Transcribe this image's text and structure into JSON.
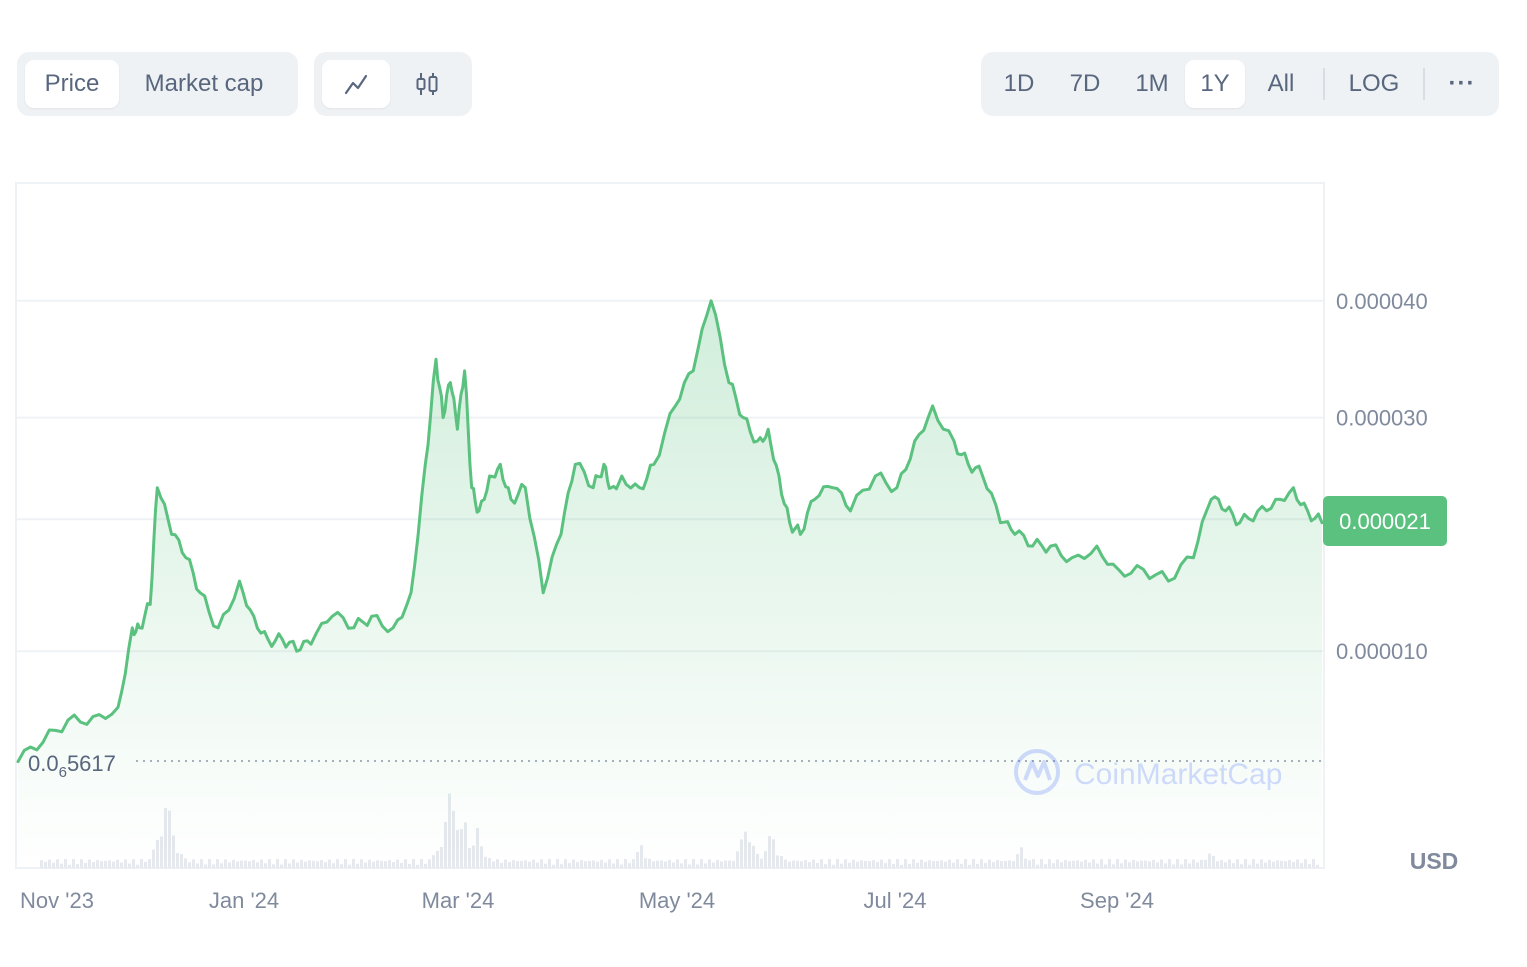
{
  "toggles": {
    "price_label": "Price",
    "market_cap_label": "Market cap",
    "line_icon": "line-chart-icon",
    "candle_icon": "candlestick-icon"
  },
  "ranges": {
    "items": [
      "1D",
      "7D",
      "1M",
      "1Y",
      "All"
    ],
    "active": "1Y",
    "log_label": "LOG",
    "more_label": "···"
  },
  "colors": {
    "line": "#5bc17f",
    "badge_bg": "#5bc17f",
    "badge_text": "#ffffff",
    "grid": "#eff2f5",
    "axis_text": "#808a9d"
  },
  "watermark": "CoinMarketCap",
  "currency_label": "USD",
  "chart_data": {
    "type": "line",
    "title": "",
    "xlabel": "",
    "ylabel": "",
    "x_ticks": [
      "Nov '23",
      "Jan '24",
      "Mar '24",
      "May '24",
      "Jul '24",
      "Sep '24"
    ],
    "y_ticks": [
      "0.000040",
      "0.000030",
      "0.000010"
    ],
    "y_tick_values": [
      4e-05,
      3e-05,
      1e-05
    ],
    "ylim": [
      0.0,
      5e-05
    ],
    "current_price_label": "0.000021",
    "current_price": 2.1e-05,
    "baseline_label_prefix": "0.0",
    "baseline_label_sub": "6",
    "baseline_label_suffix": "5617",
    "baseline_value": 5.617e-07,
    "grid": true,
    "volume_shown": true,
    "series": [
      {
        "x": [
          "2023-11-01",
          "2023-11-08",
          "2023-11-15",
          "2023-11-22",
          "2023-11-29",
          "2023-12-03",
          "2023-12-05",
          "2023-12-08",
          "2023-12-10",
          "2023-12-14",
          "2023-12-18",
          "2023-12-22",
          "2023-12-27",
          "2024-01-02",
          "2024-01-06",
          "2024-01-10",
          "2024-01-14",
          "2024-01-18",
          "2024-01-22",
          "2024-01-28",
          "2024-02-03",
          "2024-02-08",
          "2024-02-14",
          "2024-02-19",
          "2024-02-23",
          "2024-02-26",
          "2024-02-28",
          "2024-03-01",
          "2024-03-03",
          "2024-03-05",
          "2024-03-07",
          "2024-03-09",
          "2024-03-12",
          "2024-03-15",
          "2024-03-18",
          "2024-03-22",
          "2024-03-27",
          "2024-04-01",
          "2024-04-05",
          "2024-04-10",
          "2024-04-13",
          "2024-04-15",
          "2024-04-18",
          "2024-04-23",
          "2024-04-27",
          "2024-05-03",
          "2024-05-08",
          "2024-05-13",
          "2024-05-18",
          "2024-05-22",
          "2024-05-26",
          "2024-05-29",
          "2024-06-01",
          "2024-06-04",
          "2024-06-07",
          "2024-06-11",
          "2024-06-16",
          "2024-06-21",
          "2024-06-28",
          "2024-07-04",
          "2024-07-09",
          "2024-07-14",
          "2024-07-20",
          "2024-07-24",
          "2024-07-28",
          "2024-08-02",
          "2024-08-06",
          "2024-08-11",
          "2024-08-16",
          "2024-08-22",
          "2024-08-29",
          "2024-09-04",
          "2024-09-11",
          "2024-09-18",
          "2024-09-25",
          "2024-09-30",
          "2024-10-04",
          "2024-10-08",
          "2024-10-13",
          "2024-10-18",
          "2024-10-23",
          "2024-10-27",
          "2024-10-31"
        ],
        "y": [
          5.5e-07,
          2.2e-06,
          4.1e-06,
          4.4e-06,
          5.2e-06,
          1.2e-05,
          1.2e-05,
          1.4e-05,
          2.4e-05,
          2e-05,
          1.8e-05,
          1.5e-05,
          1.2e-05,
          1.6e-05,
          1.3e-05,
          1.1e-05,
          1.1e-05,
          1e-05,
          1.06e-05,
          1.3e-05,
          1.2e-05,
          1.3e-05,
          1.2e-05,
          1.5e-05,
          2.6e-05,
          3.5e-05,
          3e-05,
          3.3e-05,
          2.9e-05,
          3.4e-05,
          2.4e-05,
          2.2e-05,
          2.5e-05,
          2.6e-05,
          2.3e-05,
          2.4e-05,
          1.5e-05,
          2e-05,
          2.6e-05,
          2.4e-05,
          2.6e-05,
          2.4e-05,
          2.5e-05,
          2.4e-05,
          2.6e-05,
          3.1e-05,
          3.4e-05,
          4e-05,
          3.3e-05,
          3e-05,
          2.8e-05,
          2.9e-05,
          2.5e-05,
          2.1e-05,
          2e-05,
          2.3e-05,
          2.4e-05,
          2.2e-05,
          2.5e-05,
          2.4e-05,
          2.8e-05,
          3.1e-05,
          2.8e-05,
          2.6e-05,
          2.5e-05,
          2.1e-05,
          2e-05,
          1.9e-05,
          1.9e-05,
          1.8e-05,
          1.9e-05,
          1.7e-05,
          1.7e-05,
          1.6e-05,
          1.8e-05,
          2.3e-05,
          2.2e-05,
          2.1e-05,
          2.2e-05,
          2.3e-05,
          2.4e-05,
          2.2e-05,
          2.1e-05
        ]
      }
    ]
  }
}
